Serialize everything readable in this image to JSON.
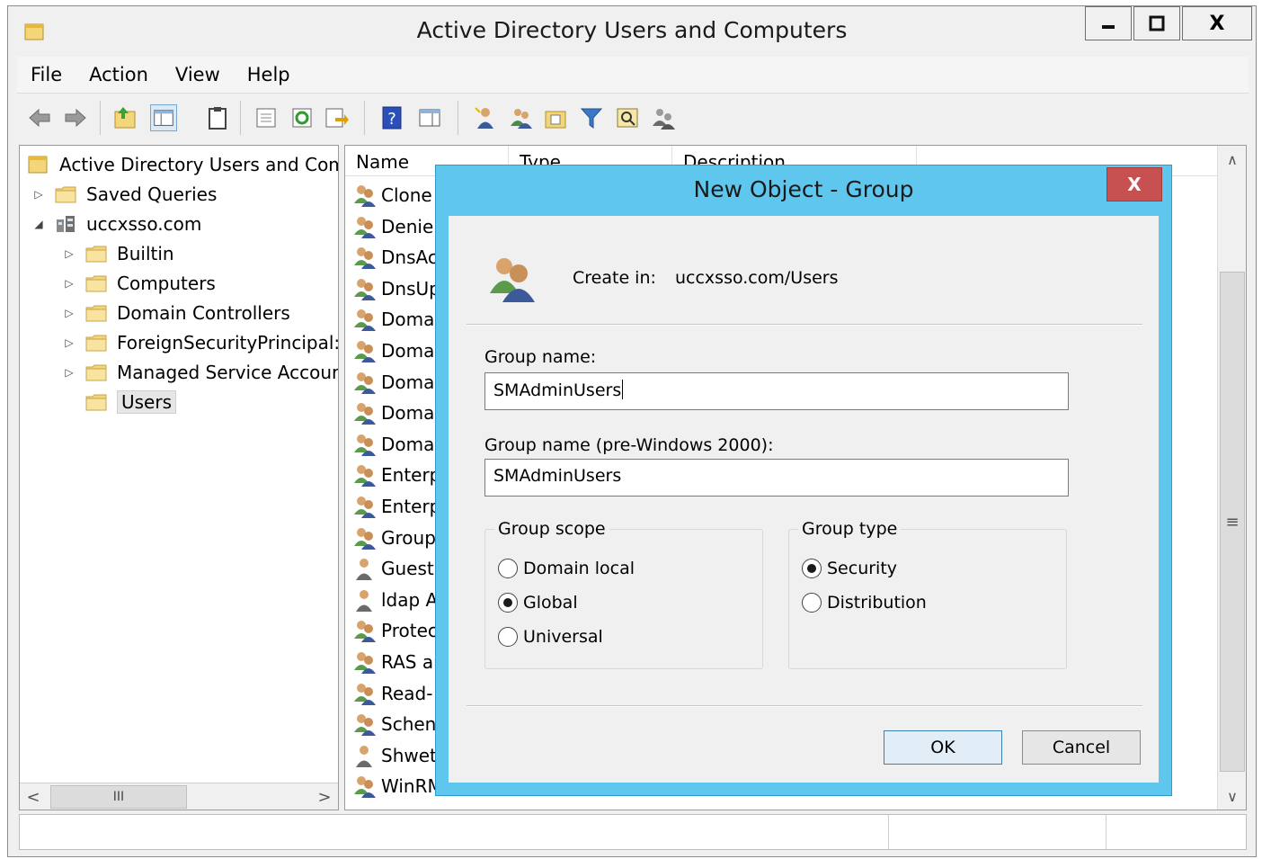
{
  "window": {
    "title": "Active Directory Users and Computers",
    "controls": {
      "minimize": "—",
      "maximize": "□",
      "close": "X"
    }
  },
  "menu": [
    "File",
    "Action",
    "View",
    "Help"
  ],
  "tree": {
    "root": "Active Directory Users and Com",
    "items": [
      {
        "label": "Saved Queries",
        "depth": 1,
        "expander": "▷"
      },
      {
        "label": "uccxsso.com",
        "depth": 1,
        "expander": "◢"
      },
      {
        "label": "Builtin",
        "depth": 2,
        "expander": "▷"
      },
      {
        "label": "Computers",
        "depth": 2,
        "expander": "▷"
      },
      {
        "label": "Domain Controllers",
        "depth": 2,
        "expander": "▷"
      },
      {
        "label": "ForeignSecurityPrincipal:",
        "depth": 2,
        "expander": "▷"
      },
      {
        "label": "Managed Service Accour",
        "depth": 2,
        "expander": "▷"
      },
      {
        "label": "Users",
        "depth": 2,
        "expander": "",
        "selected": true
      }
    ],
    "hscroll": {
      "left": "<",
      "right": ">",
      "thumb": "III"
    }
  },
  "list": {
    "columns": [
      "Name",
      "Type",
      "Description"
    ],
    "rows": [
      {
        "name": "Clone",
        "icon": "group-icon"
      },
      {
        "name": "Denie",
        "icon": "group-icon"
      },
      {
        "name": "DnsAc",
        "icon": "group-icon"
      },
      {
        "name": "DnsUp",
        "icon": "group-icon"
      },
      {
        "name": "Doma",
        "icon": "group-icon"
      },
      {
        "name": "Doma",
        "icon": "group-icon"
      },
      {
        "name": "Doma",
        "icon": "group-icon"
      },
      {
        "name": "Doma",
        "icon": "group-icon"
      },
      {
        "name": "Doma",
        "icon": "group-icon"
      },
      {
        "name": "Enterp",
        "icon": "group-icon"
      },
      {
        "name": "Enterp",
        "icon": "group-icon"
      },
      {
        "name": "Group",
        "icon": "group-icon"
      },
      {
        "name": "Guest",
        "icon": "user-icon"
      },
      {
        "name": "ldap A",
        "icon": "user-icon"
      },
      {
        "name": "Protec",
        "icon": "group-icon"
      },
      {
        "name": "RAS ar",
        "icon": "group-icon"
      },
      {
        "name": "Read-",
        "icon": "group-icon"
      },
      {
        "name": "Schen",
        "icon": "group-icon"
      },
      {
        "name": "Shwet",
        "icon": "user-icon"
      },
      {
        "name": "WinRM",
        "icon": "group-icon"
      }
    ],
    "vscroll": {
      "up": "∧",
      "down": "∨",
      "thumb": "≡"
    }
  },
  "dialog": {
    "title": "New Object - Group",
    "close": "X",
    "create_in_label": "Create in:",
    "create_in_value": "uccxsso.com/Users",
    "group_name_label": "Group name:",
    "group_name_value": "SMAdminUsers",
    "group_name_pre2000_label": "Group name (pre-Windows 2000):",
    "group_name_pre2000_value": "SMAdminUsers",
    "group_scope": {
      "legend": "Group scope",
      "options": [
        {
          "label": "Domain local",
          "checked": false
        },
        {
          "label": "Global",
          "checked": true
        },
        {
          "label": "Universal",
          "checked": false
        }
      ]
    },
    "group_type": {
      "legend": "Group type",
      "options": [
        {
          "label": "Security",
          "checked": true
        },
        {
          "label": "Distribution",
          "checked": false
        }
      ]
    },
    "ok_label": "OK",
    "cancel_label": "Cancel"
  },
  "colors": {
    "dialog_frame": "#5fc7ee",
    "close_button": "#c75050",
    "folder": "#f3d57a"
  }
}
